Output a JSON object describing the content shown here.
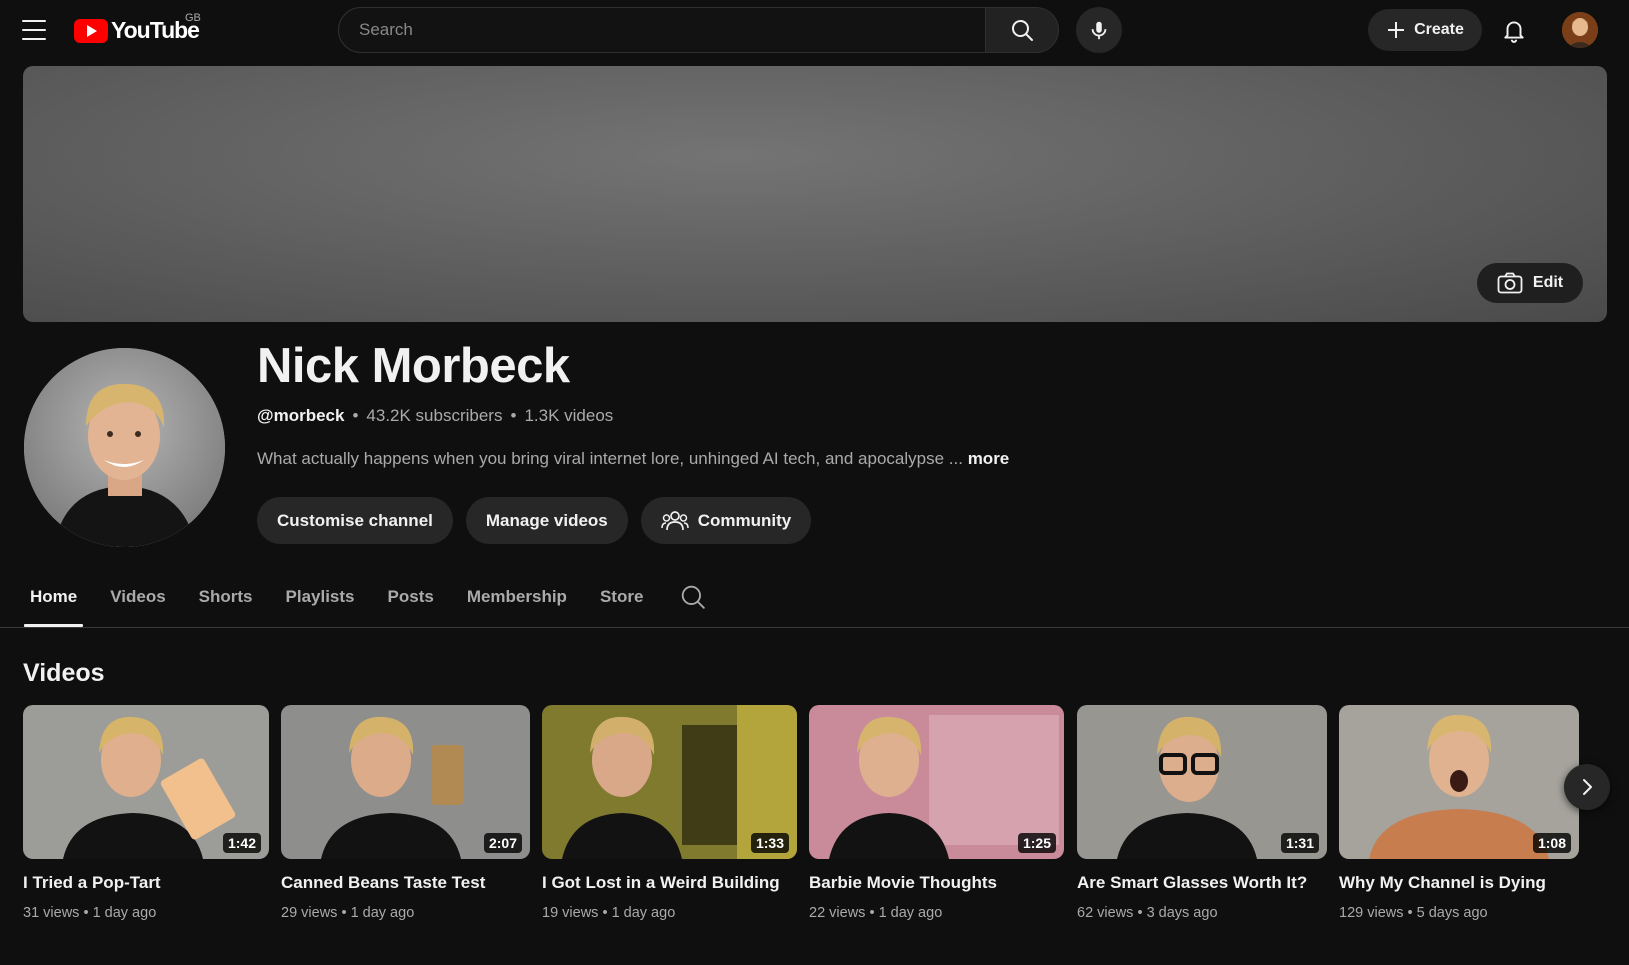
{
  "header": {
    "logo_text": "YouTube",
    "region": "GB",
    "search_placeholder": "Search",
    "create_label": "Create"
  },
  "banner": {
    "edit_label": "Edit"
  },
  "channel": {
    "name": "Nick Morbeck",
    "handle": "@morbeck",
    "subscribers": "43.2K subscribers",
    "videos": "1.3K videos",
    "description": "What actually happens when you bring viral internet lore, unhinged AI tech, and apocalypse ...",
    "more_label": "more"
  },
  "actions": {
    "customise": "Customise channel",
    "manage": "Manage videos",
    "community": "Community"
  },
  "tabs": [
    "Home",
    "Videos",
    "Shorts",
    "Playlists",
    "Posts",
    "Membership",
    "Store"
  ],
  "active_tab": "Home",
  "section_title": "Videos",
  "videos": [
    {
      "title": "I Tried a Pop-Tart",
      "duration": "1:42",
      "views": "31 views",
      "age": "1 day ago"
    },
    {
      "title": "Canned Beans Taste Test",
      "duration": "2:07",
      "views": "29 views",
      "age": "1 day ago"
    },
    {
      "title": "I Got Lost in a Weird Building",
      "duration": "1:33",
      "views": "19 views",
      "age": "1 day ago"
    },
    {
      "title": "Barbie Movie Thoughts",
      "duration": "1:25",
      "views": "22 views",
      "age": "1 day ago"
    },
    {
      "title": "Are Smart Glasses Worth It?",
      "duration": "1:31",
      "views": "62 views",
      "age": "3 days ago"
    },
    {
      "title": "Why My Channel is Dying",
      "duration": "1:08",
      "views": "129 views",
      "age": "5 days ago"
    }
  ],
  "colors": {
    "background": "#0f0f0f",
    "logo_red": "#ff0000",
    "pill_bg": "#272727",
    "muted_text": "#aaaaaa"
  }
}
